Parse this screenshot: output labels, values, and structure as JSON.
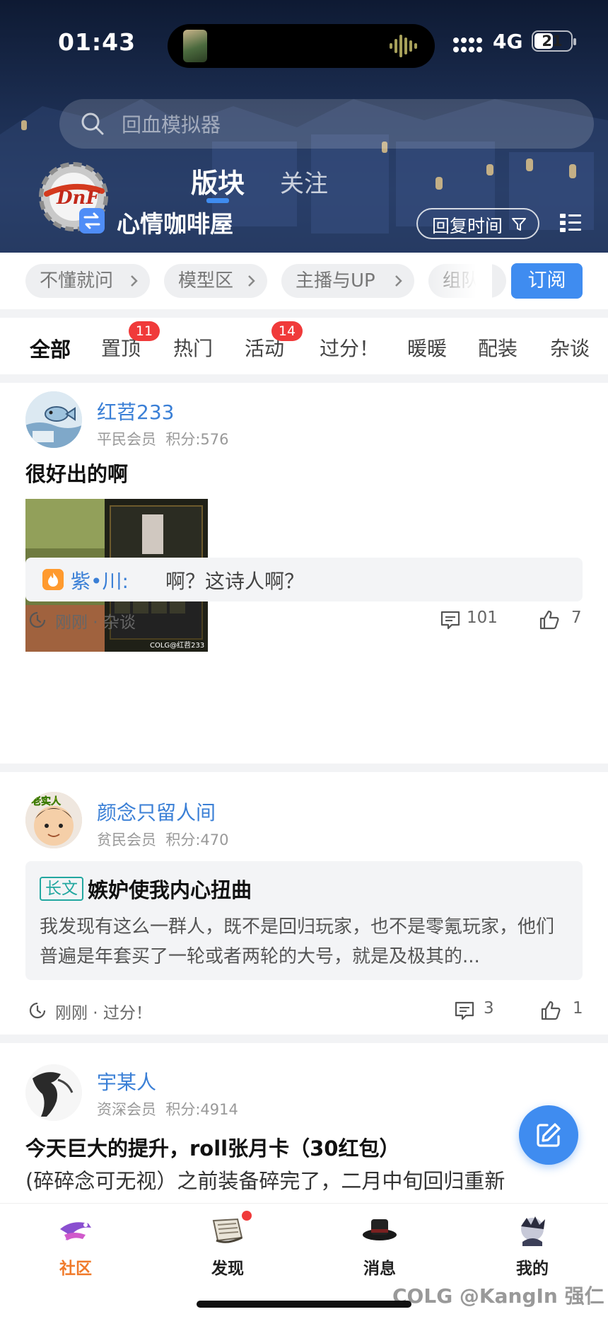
{
  "status_bar": {
    "time": "01:43",
    "network": "4G",
    "battery": "21"
  },
  "search": {
    "placeholder": "回血模拟器"
  },
  "header": {
    "tabs": [
      "版块",
      "关注"
    ],
    "active_tab": "版块",
    "forum_name": "心情咖啡屋",
    "sort_label": "回复时间"
  },
  "subforums": {
    "items": [
      "不懂就问",
      "模型区",
      "主播与UP",
      "组队"
    ],
    "subscribe_label": "订阅"
  },
  "categories": [
    {
      "label": "全部",
      "active": true
    },
    {
      "label": "置顶",
      "badge": "11"
    },
    {
      "label": "热门"
    },
    {
      "label": "活动",
      "badge": "14"
    },
    {
      "label": "过分！"
    },
    {
      "label": "暖暖"
    },
    {
      "label": "配装"
    },
    {
      "label": "杂谈"
    }
  ],
  "posts": [
    {
      "user": "红苕233",
      "rank": "平民会员",
      "points": "积分:576",
      "title": "很好出的啊",
      "image_watermark": "COLG@红苕233",
      "quote_user": "紫•川:",
      "quote_text": "啊？这诗人啊？",
      "time_category": "刚刚 · 杂谈",
      "comments": "101",
      "likes": "7"
    },
    {
      "user": "颜念只留人间",
      "avatar_text": "老实人",
      "rank": "贫民会员",
      "points": "积分:470",
      "tag": "长文",
      "title": "嫉妒使我内心扭曲",
      "excerpt": "我发现有这么一群人，既不是回归玩家，也不是零氪玩家，他们普遍是年套买了一轮或者两轮的大号，就是及极其的...",
      "time_category": "刚刚 · 过分！",
      "comments": "3",
      "likes": "1"
    },
    {
      "user": "宇某人",
      "rank": "资深会员",
      "points": "积分:4914",
      "title": "今天巨大的提升，roll张月卡（30红包）",
      "body": "(碎碎念可无视）之前装备碎完了，二月中旬回归重新"
    }
  ],
  "bottom_nav": [
    {
      "label": "社区",
      "active": true
    },
    {
      "label": "发现"
    },
    {
      "label": "消息"
    },
    {
      "label": "我的"
    }
  ],
  "watermark": "COLG @KangIn 强仁",
  "colors": {
    "accent": "#3f8cf0",
    "badge": "#f03a3a",
    "active_nav": "#f07a2a",
    "username": "#3a7fd6"
  }
}
